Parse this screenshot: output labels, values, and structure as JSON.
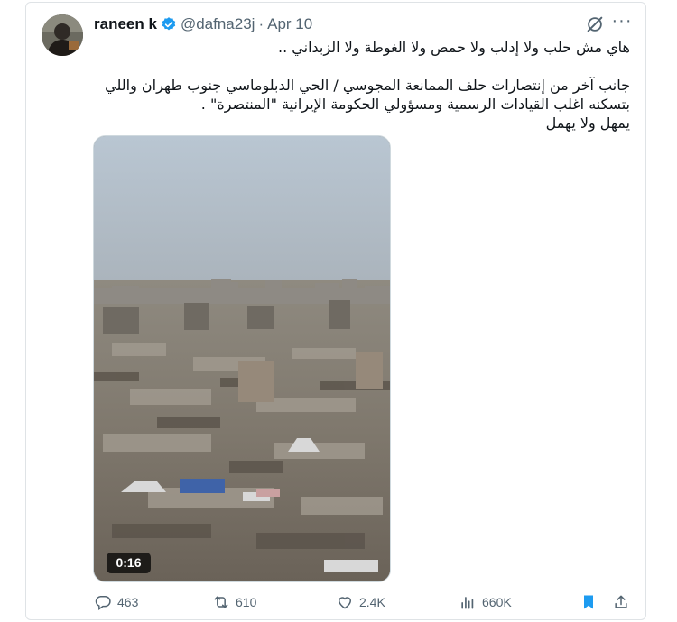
{
  "tweet": {
    "author_name": "raneen k",
    "handle": "@dafna23j",
    "separator": "·",
    "date": "Apr 10",
    "text_lines": [
      "هاي مش حلب ولا إدلب ولا حمص ولا الغوطة ولا الزبداني ..",
      "",
      "جانب آخر من إنتصارات حلف الممانعة المجوسي / الحي الدبلوماسي جنوب طهران واللي",
      "بتسكنه اغلب القيادات الرسمية ومسؤولي الحكومة الإيرانية \"المنتصرة\" .",
      "يمهل ولا يهمل"
    ],
    "media": {
      "duration": "0:16"
    },
    "stats": {
      "replies": "463",
      "reposts": "610",
      "likes": "2.4K",
      "views": "660K"
    }
  },
  "icons": {
    "verified": "verified-badge-icon",
    "grok": "grok-icon",
    "more": "more-icon",
    "reply": "reply-icon",
    "repost": "repost-icon",
    "like": "like-icon",
    "views": "views-icon",
    "bookmark": "bookmark-icon",
    "share": "share-icon"
  },
  "colors": {
    "text": "#0f1419",
    "secondary": "#536471",
    "verified": "#1d9bf0",
    "bookmark": "#1d9bf0"
  }
}
